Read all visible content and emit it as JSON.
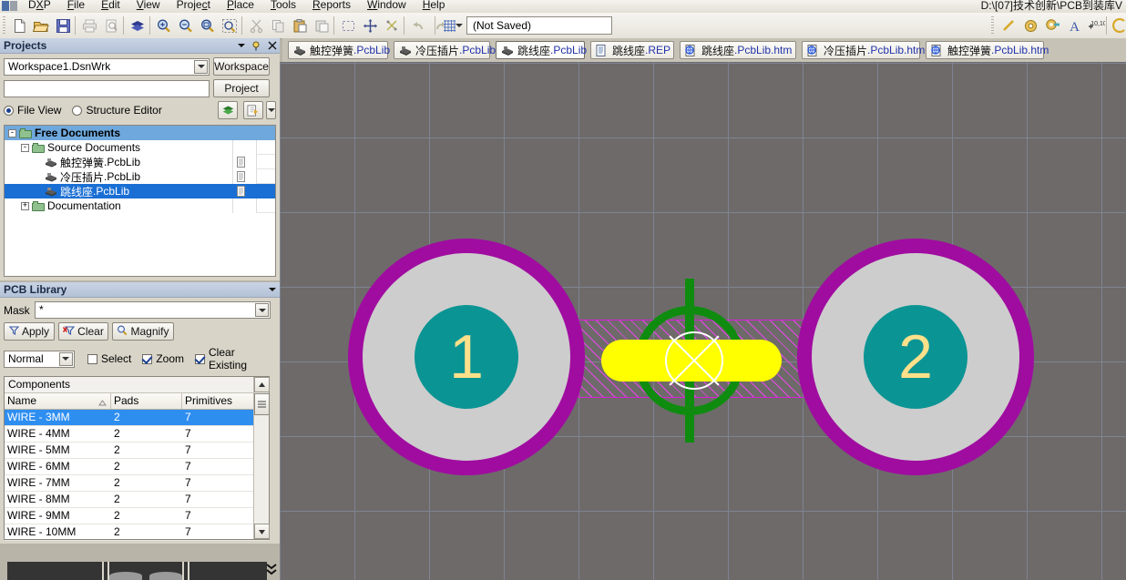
{
  "window": {
    "title_path": "D:\\[07]技术创新\\PCB到装库V",
    "app_name": "DXP"
  },
  "menubar": {
    "logo": "altium-logo-icon",
    "items": [
      {
        "label": "DXP",
        "accel": "X"
      },
      {
        "label": "File",
        "accel": "F"
      },
      {
        "label": "Edit",
        "accel": "E"
      },
      {
        "label": "View",
        "accel": "V"
      },
      {
        "label": "Project",
        "accel": "c"
      },
      {
        "label": "Place",
        "accel": "P"
      },
      {
        "label": "Tools",
        "accel": "T"
      },
      {
        "label": "Reports",
        "accel": "R"
      },
      {
        "label": "Window",
        "accel": "W"
      },
      {
        "label": "Help",
        "accel": "H"
      }
    ]
  },
  "toolbar": {
    "buttons": [
      {
        "name": "new-document-icon"
      },
      {
        "name": "open-document-icon"
      },
      {
        "name": "save-icon"
      },
      {
        "name": "print-icon"
      },
      {
        "name": "print-preview-icon"
      },
      {
        "name": "layers-icon"
      },
      {
        "name": "zoom-in-icon"
      },
      {
        "name": "zoom-out-icon"
      },
      {
        "name": "zoom-document-icon"
      },
      {
        "name": "zoom-selection-icon"
      },
      {
        "name": "cut-icon"
      },
      {
        "name": "copy-icon"
      },
      {
        "name": "paste-icon"
      },
      {
        "name": "paste-special-icon"
      },
      {
        "name": "select-area-icon"
      },
      {
        "name": "move-icon"
      },
      {
        "name": "deselect-all-icon"
      },
      {
        "name": "undo-icon"
      },
      {
        "name": "redo-icon"
      },
      {
        "name": "grid-icon"
      }
    ],
    "right_buttons": [
      {
        "name": "place-line-icon"
      },
      {
        "name": "place-pad-icon"
      },
      {
        "name": "place-via-icon"
      },
      {
        "name": "place-string-icon"
      },
      {
        "name": "place-coordinate-icon"
      },
      {
        "name": "place-arc-icon"
      }
    ],
    "document_selector": {
      "value": "(Not Saved)",
      "placeholder": "(Not Saved)"
    }
  },
  "tabs": [
    {
      "label": "触控弹簧",
      "ext": ".PcbLib",
      "icon": "pcblib-icon",
      "active": false
    },
    {
      "label": "冷压插片",
      "ext": ".PcbLib",
      "icon": "pcblib-icon",
      "active": false
    },
    {
      "label": "跳线座",
      "ext": ".PcbLib",
      "icon": "pcblib-icon",
      "active": true
    },
    {
      "label": "跳线座",
      "ext": ".REP",
      "icon": "report-icon",
      "active": false
    },
    {
      "label": "跳线座",
      "ext": ".PcbLib.htm",
      "icon": "html-icon",
      "active": false
    },
    {
      "label": "冷压插片",
      "ext": ".PcbLib.htm",
      "icon": "html-icon",
      "active": false
    },
    {
      "label": "触控弹簧",
      "ext": ".PcbLib.htm",
      "icon": "html-icon",
      "active": false
    }
  ],
  "projects_panel": {
    "title": "Projects",
    "header_icons": [
      "chevron-down-icon",
      "pin-icon",
      "close-icon"
    ],
    "workspace_combo": {
      "value": "Workspace1.DsnWrk"
    },
    "workspace_button": "Workspace",
    "project_combo": {
      "value": ""
    },
    "project_button": "Project",
    "view_modes": [
      {
        "label": "File View",
        "selected": true
      },
      {
        "label": "Structure Editor",
        "selected": false
      }
    ],
    "toolbar_icons": [
      "layers-icon",
      "open-project-icon",
      "chevron-down-icon"
    ],
    "tree": [
      {
        "label": "Free Documents",
        "level": 0,
        "expander": "-",
        "icon": "folder-icon",
        "bold": true,
        "selected_row": true,
        "doc_icon": false
      },
      {
        "label": "Source Documents",
        "level": 1,
        "expander": "-",
        "icon": "folder-icon",
        "bold": false,
        "selected_row": false,
        "doc_icon": false
      },
      {
        "label": "触控弹簧",
        "ext": ".PcbLib",
        "level": 2,
        "expander": "",
        "icon": "pcblib-icon",
        "bold": false,
        "selected_row": false,
        "doc_icon": true
      },
      {
        "label": "冷压插片",
        "ext": ".PcbLib",
        "level": 2,
        "expander": "",
        "icon": "pcblib-icon",
        "bold": false,
        "selected_row": false,
        "doc_icon": true
      },
      {
        "label": "跳线座",
        "ext": ".PcbLib",
        "level": 2,
        "expander": "",
        "icon": "pcblib-icon",
        "bold": false,
        "selected_row": true,
        "highlight_label": true,
        "doc_icon": true
      },
      {
        "label": "Documentation",
        "level": 1,
        "expander": "+",
        "icon": "folder-icon",
        "bold": false,
        "selected_row": false,
        "doc_icon": false
      }
    ]
  },
  "pcblib_panel": {
    "title": "PCB Library",
    "header_icons": [
      "chevron-down-icon"
    ],
    "mask_label": "Mask",
    "mask_value": "*",
    "buttons": [
      {
        "label": "Apply",
        "icon": "filter-icon"
      },
      {
        "label": "Clear",
        "icon": "clear-filter-icon"
      },
      {
        "label": "Magnify",
        "icon": "magnify-icon"
      }
    ],
    "mode_select": {
      "value": "Normal"
    },
    "options": [
      {
        "label": "Select",
        "accel": "S",
        "checked": false
      },
      {
        "label": "Zoom",
        "accel": "Z",
        "checked": true
      },
      {
        "label": "Clear Existing",
        "accel": "C",
        "checked": true
      }
    ],
    "components_caption": "Components",
    "columns": [
      "Name",
      "Pads",
      "Primitives"
    ],
    "sort_column": "Name",
    "rows": [
      {
        "name": "WIRE - 3MM",
        "pads": "2",
        "primitives": "7",
        "selected": true
      },
      {
        "name": "WIRE - 4MM",
        "pads": "2",
        "primitives": "7",
        "selected": false
      },
      {
        "name": "WIRE - 5MM",
        "pads": "2",
        "primitives": "7",
        "selected": false
      },
      {
        "name": "WIRE - 6MM",
        "pads": "2",
        "primitives": "7",
        "selected": false
      },
      {
        "name": "WIRE - 7MM",
        "pads": "2",
        "primitives": "7",
        "selected": false
      },
      {
        "name": "WIRE - 8MM",
        "pads": "2",
        "primitives": "7",
        "selected": false
      },
      {
        "name": "WIRE - 9MM",
        "pads": "2",
        "primitives": "7",
        "selected": false
      },
      {
        "name": "WIRE - 10MM",
        "pads": "2",
        "primitives": "7",
        "selected": false
      }
    ]
  },
  "canvas": {
    "background_color": "#6e6a6a",
    "grid_color": "#7d8491",
    "grid_spacing_px": 82,
    "pads": [
      {
        "designator": "1",
        "ring_color": "#a00ca0",
        "body_color": "#cdcdcd",
        "hole_color": "#0b9494",
        "text_color": "#ffe08a"
      },
      {
        "designator": "2",
        "ring_color": "#a00ca0",
        "body_color": "#cdcdcd",
        "hole_color": "#0b9494",
        "text_color": "#ffe08a"
      }
    ],
    "track": {
      "color": "#ffff00",
      "name": "yellow-track"
    },
    "keepout": {
      "color": "#ea47ea",
      "name": "magenta-hatch-region"
    },
    "origin_marker": {
      "color": "#0f8c0f",
      "name": "green-crosshair"
    },
    "cursor": {
      "color": "#ffffff",
      "name": "white-crosshair-cursor"
    }
  },
  "status_bar": {
    "panel_tabs_icon": "panel-tabs-icon",
    "expand_icon": "expand-collapse-icon"
  }
}
